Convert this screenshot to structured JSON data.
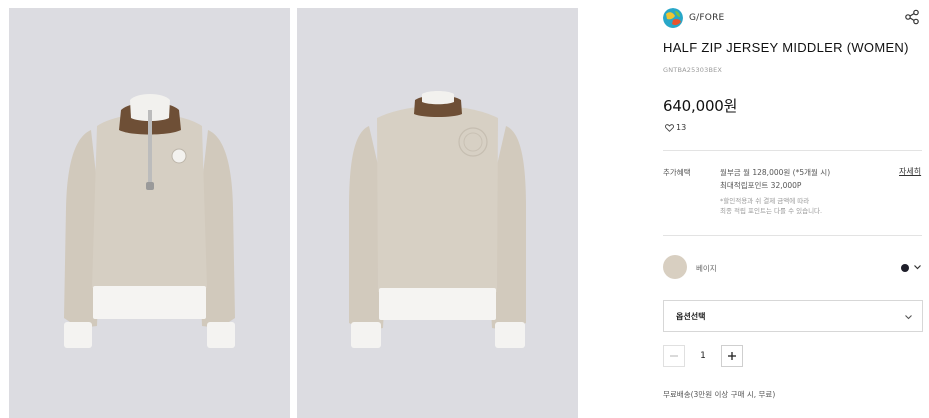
{
  "images": [
    {
      "label": "front",
      "alt": ""
    },
    {
      "label": "back",
      "alt": ""
    }
  ],
  "brand": {
    "name": "G/FORE",
    "logo_icon": "brand-logo-icon"
  },
  "share_icon": "share-icon",
  "product": {
    "title": "HALF ZIP JERSEY MIDDLER (WOMEN)",
    "code": "GNTBA25303BEX",
    "price": "640,000원",
    "likes": "13",
    "likes_icon": "heart-icon"
  },
  "benefits": {
    "label": "추가혜택",
    "line1": "월부금 월 128,000원 (*5개월 시)",
    "line2": "최대적립포인트 32,000P",
    "note1": "*할인적용과 쉬 결제 금액에 따라",
    "note2": "최종 적립 포인트는 다를 수 있습니다.",
    "detail_link": "자세히"
  },
  "color": {
    "selected_name": "베이지",
    "selected_hex": "#d8cfc1",
    "alt_swatch_hex": "#1e1e2a"
  },
  "option": {
    "placeholder": "옵션선택"
  },
  "quantity": {
    "value": "1"
  },
  "shipping": "무료배송(3만원 이상 구매 시, 무료)"
}
